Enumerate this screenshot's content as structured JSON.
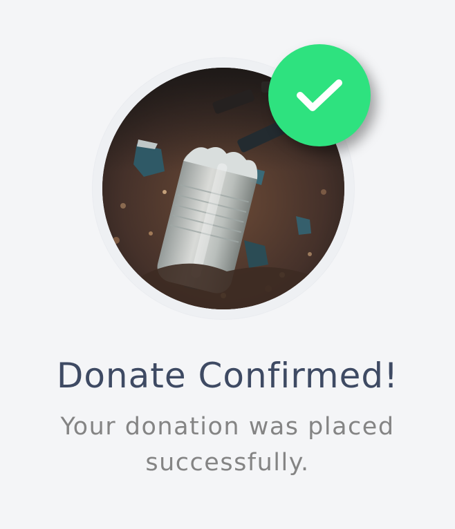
{
  "confirmation": {
    "title": "Donate Confirmed!",
    "message_line1": "Your donation was placed",
    "message_line2": "successfully."
  },
  "image": {
    "subject": "plastic-bottle-in-soil",
    "badge_icon": "checkmark-icon"
  },
  "colors": {
    "background": "#f4f5f7",
    "badge": "#2ee27f",
    "title": "#3e4a63",
    "message": "#848484"
  }
}
